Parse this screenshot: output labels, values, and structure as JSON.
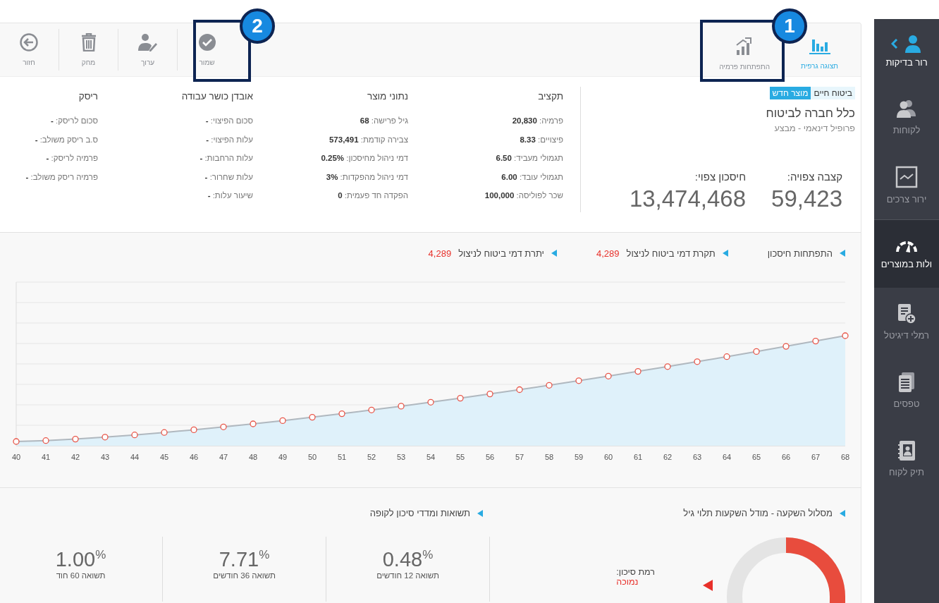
{
  "sidebar": {
    "header": {
      "label": "רור בדיקות"
    },
    "items": [
      {
        "label": "לקוחות",
        "selected": false
      },
      {
        "label": "ירור צרכים",
        "selected": false
      },
      {
        "label": "ולות במוצרים",
        "selected": true
      },
      {
        "label": "רמלי דיגיטל",
        "selected": false
      },
      {
        "label": "טפסים",
        "selected": false
      },
      {
        "label": "תיק לקוח",
        "selected": false
      }
    ]
  },
  "toolbar": {
    "views": [
      {
        "label": "תצוגה גרפית",
        "selected": true
      },
      {
        "label": "התפתחות פרמיה",
        "selected": false
      }
    ],
    "actions": [
      {
        "label": "שמור"
      },
      {
        "label": "ערוך"
      },
      {
        "label": "מחק"
      },
      {
        "label": "חזור"
      }
    ]
  },
  "callouts": [
    {
      "label": "1"
    },
    {
      "label": "2"
    }
  ],
  "product": {
    "tags": [
      {
        "label": "ביטוח חיים",
        "kind": "light"
      },
      {
        "label": "מוצר חדש",
        "kind": "strong"
      }
    ],
    "company": "כלל חברה לביטוח",
    "profile": "פרופיל דינאמי - מבצע",
    "stats": [
      {
        "label": "קצבה צפויה:",
        "value": "59,423"
      },
      {
        "label": "חיסכון צפוי:",
        "value": "13,474,468"
      }
    ]
  },
  "info_columns": [
    {
      "title": "תקציב",
      "rows": [
        "פרמיה: **20,830**",
        "פיצויים: **8.33**",
        "תגמולי מעביד: **6.50**",
        "תגמולי עובד: **6.00**",
        "שכר לפוליסה: **100,000**"
      ]
    },
    {
      "title": "נתוני מוצר",
      "rows": [
        "גיל פרישה: **68**",
        "צבירה קודמת: **573,491**",
        "דמי ניהול מחיסכון: **0.25%**",
        "דמי ניהול מהפקדות: **3%**",
        "הפקדה חד פעמית: **0**"
      ]
    },
    {
      "title": "אובדן כושר עבודה",
      "rows": [
        "סכום הפיצוי: **-**",
        "עלות הפיצוי: **-**",
        "עלות הרחבות: **-**",
        "עלות שחרור: **-**",
        "שיעור עלות: **-**"
      ]
    },
    {
      "title": "ריסק",
      "rows": [
        "סכום לריסק: **-**",
        "ס.ב ריסק משולב: **-**",
        "פרמיה לריסק: **-**",
        "פרמיה ריסק משולב: **-**"
      ]
    }
  ],
  "chart": {
    "legend": [
      {
        "label": "התפתחות חיסכון"
      },
      {
        "label": "תקרת דמי ביטוח לניצול",
        "value": "4,289"
      },
      {
        "label": "יתרת דמי ביטוח לניצול",
        "value": "4,289"
      }
    ],
    "x_labels": [
      "68",
      "67",
      "66",
      "65",
      "64",
      "63",
      "62",
      "61",
      "60",
      "59",
      "58",
      "57",
      "56",
      "55",
      "54",
      "53",
      "52",
      "51",
      "50",
      "49",
      "48",
      "47",
      "46",
      "45",
      "44",
      "43",
      "42",
      "41",
      "40"
    ]
  },
  "investment": {
    "title": "מסלול השקעה - מודל השקעות תלוי גיל",
    "risk_label": "רמת סיכון:",
    "risk_value": "נמוכה"
  },
  "returns": {
    "title": "תשואות ומדדי סיכון לקופה",
    "items": [
      {
        "value": "0.48$^{%}$",
        "label": "תשואה 12 חודשים"
      },
      {
        "value": "7.71$^{%}$",
        "label": "תשואה 36 חודשים"
      },
      {
        "value": "1.00$^{%}$",
        "label": "תשואה 60 חוד"
      }
    ]
  }
}
